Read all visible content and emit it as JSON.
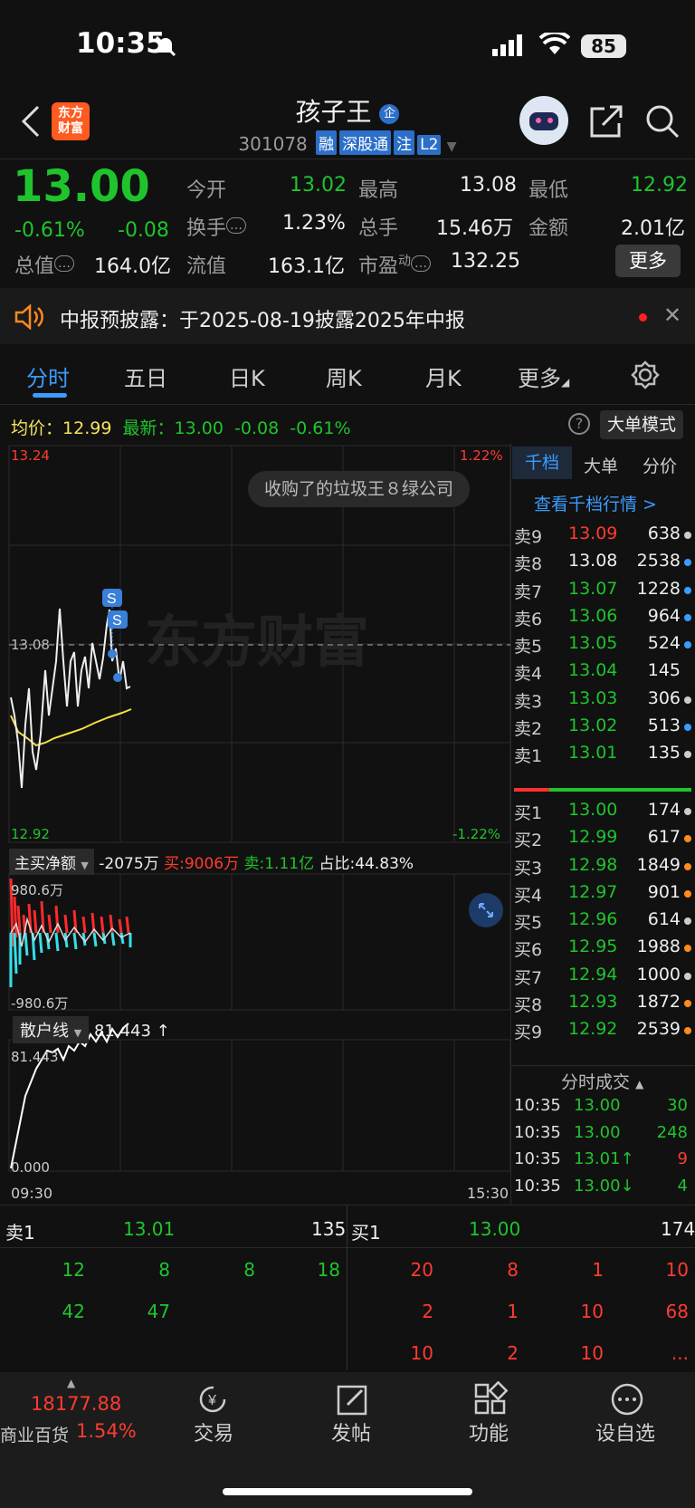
{
  "status": {
    "time": "10:35",
    "battery": "85"
  },
  "header": {
    "logo": "东方\n财富",
    "title": "孩子王",
    "badge": "企",
    "code": "301078",
    "tags": [
      "融",
      "深股通",
      "注",
      "L2"
    ]
  },
  "quote": {
    "price": "13.00",
    "pct": "-0.61%",
    "chg": "-0.08",
    "rows": [
      [
        {
          "label": "今开",
          "value": "13.02",
          "color": "green"
        },
        {
          "label": "最高",
          "value": "13.08",
          "color": "white"
        },
        {
          "label": "最低",
          "value": "12.92",
          "color": "green"
        }
      ],
      [
        {
          "label": "换手",
          "value": "1.23%",
          "color": "white"
        },
        {
          "label": "总手",
          "value": "15.46万",
          "color": "white"
        },
        {
          "label": "金额",
          "value": "2.01亿",
          "color": "white"
        }
      ]
    ],
    "total_label": "总值",
    "total_value": "164.0亿",
    "float_label": "流值",
    "float_value": "163.1亿",
    "pe_label": "市盈",
    "pe_sup": "动",
    "pe_value": "132.25",
    "more": "更多"
  },
  "notice": {
    "text": "中报预披露：于2025-08-19披露2025年中报"
  },
  "tabs": [
    "分时",
    "五日",
    "日K",
    "周K",
    "月K",
    "更多"
  ],
  "chart_info": {
    "avg_label": "均价：",
    "avg_value": "12.99",
    "latest_label": "最新：",
    "latest_value": "13.00",
    "chg": "-0.08",
    "pct": "-0.61%",
    "mode_btn": "大单模式"
  },
  "chart_labels": {
    "top_price": "13.24",
    "top_pct": "1.22%",
    "bottom_price": "12.92",
    "bottom_pct": "-1.22%",
    "ref_price": "13.08",
    "comment": "收购了的垃圾王８绿公司",
    "watermark": "东方财富",
    "marker": "S",
    "start_time": "09:30",
    "end_time": "15:30"
  },
  "net_flow": {
    "label": "主买净额",
    "value": "-2075万",
    "buy": "买:9006万",
    "sell": "卖:1.11亿",
    "ratio": "占比:44.83%",
    "top": "980.6万",
    "bottom": "-980.6万"
  },
  "retail": {
    "label": "散户线",
    "value": "81.443 ↑",
    "top": "81.443",
    "bottom": "0.000"
  },
  "orderbook": {
    "tabs": [
      "千档",
      "大单",
      "分价"
    ],
    "link": "查看千档行情 >",
    "asks": [
      {
        "label": "卖9",
        "price": "13.09",
        "vol": "638",
        "pc": "red",
        "dot": "#ccc"
      },
      {
        "label": "卖8",
        "price": "13.08",
        "vol": "2538",
        "pc": "white",
        "dot": "#3a9cff"
      },
      {
        "label": "卖7",
        "price": "13.07",
        "vol": "1228",
        "pc": "green",
        "dot": "#3a9cff"
      },
      {
        "label": "卖6",
        "price": "13.06",
        "vol": "964",
        "pc": "green",
        "dot": "#3a9cff"
      },
      {
        "label": "卖5",
        "price": "13.05",
        "vol": "524",
        "pc": "green",
        "dot": "#3a9cff"
      },
      {
        "label": "卖4",
        "price": "13.04",
        "vol": "145",
        "pc": "green",
        "dot": ""
      },
      {
        "label": "卖3",
        "price": "13.03",
        "vol": "306",
        "pc": "green",
        "dot": "#ccc"
      },
      {
        "label": "卖2",
        "price": "13.02",
        "vol": "513",
        "pc": "green",
        "dot": "#3a9cff"
      },
      {
        "label": "卖1",
        "price": "13.01",
        "vol": "135",
        "pc": "green",
        "dot": "#ccc"
      }
    ],
    "bids": [
      {
        "label": "买1",
        "price": "13.00",
        "vol": "174",
        "pc": "green",
        "dot": "#ccc"
      },
      {
        "label": "买2",
        "price": "12.99",
        "vol": "617",
        "pc": "green",
        "dot": "#ff8a1e"
      },
      {
        "label": "买3",
        "price": "12.98",
        "vol": "1849",
        "pc": "green",
        "dot": "#ff8a1e"
      },
      {
        "label": "买4",
        "price": "12.97",
        "vol": "901",
        "pc": "green",
        "dot": "#ff8a1e"
      },
      {
        "label": "买5",
        "price": "12.96",
        "vol": "614",
        "pc": "green",
        "dot": "#ccc"
      },
      {
        "label": "买6",
        "price": "12.95",
        "vol": "1988",
        "pc": "green",
        "dot": "#ff8a1e"
      },
      {
        "label": "买7",
        "price": "12.94",
        "vol": "1000",
        "pc": "green",
        "dot": "#ccc"
      },
      {
        "label": "买8",
        "price": "12.93",
        "vol": "1872",
        "pc": "green",
        "dot": "#ff8a1e"
      },
      {
        "label": "买9",
        "price": "12.92",
        "vol": "2539",
        "pc": "green",
        "dot": "#ff8a1e"
      }
    ],
    "ticks_title": "分时成交",
    "ticks": [
      {
        "time": "10:35",
        "price": "13.00",
        "vol": "30",
        "vc": "green"
      },
      {
        "time": "10:35",
        "price": "13.00",
        "vol": "248",
        "vc": "green"
      },
      {
        "time": "10:35",
        "price": "13.01↑",
        "vol": "9",
        "vc": "red"
      },
      {
        "time": "10:35",
        "price": "13.00↓",
        "vol": "4",
        "vc": "green"
      }
    ]
  },
  "queue": {
    "sell_label": "卖1",
    "sell_price": "13.01",
    "sell_vol": "135",
    "buy_label": "买1",
    "buy_price": "13.00",
    "buy_vol": "174",
    "sell_rows": [
      [
        "12",
        "8",
        "8",
        "18"
      ],
      [
        "42",
        "47",
        "",
        ""
      ]
    ],
    "buy_rows": [
      [
        "20",
        "8",
        "1",
        "10"
      ],
      [
        "2",
        "1",
        "10",
        "68"
      ],
      [
        "10",
        "2",
        "10",
        "..."
      ]
    ]
  },
  "nav": {
    "index_value": "18177.88",
    "index_name": "商业百货",
    "index_pct": "1.54%",
    "items": [
      "交易",
      "发帖",
      "功能",
      "设自选"
    ]
  }
}
